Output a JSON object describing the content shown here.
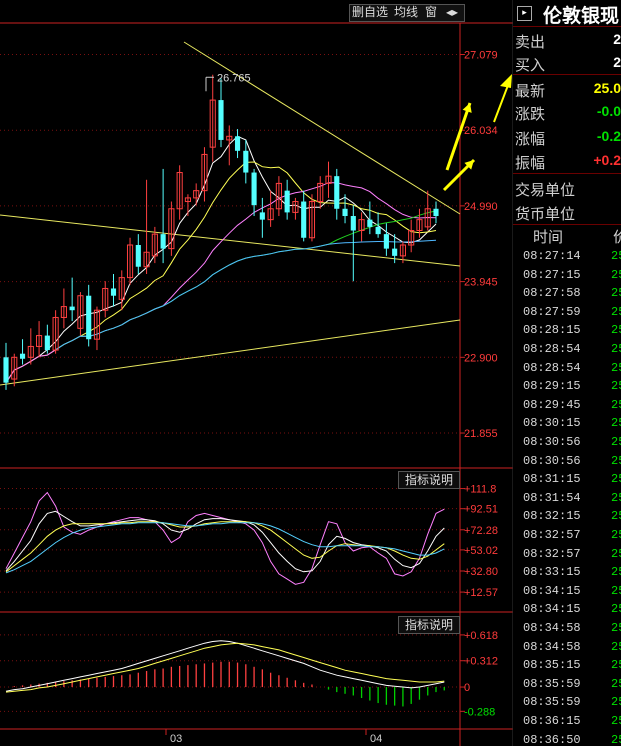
{
  "toolbar": {
    "btn1": "删自选",
    "btn2": "均线",
    "btn3": "窗",
    "btn4": "◂▸"
  },
  "indicator_buttons": {
    "first": "指标说明",
    "second": "指标说明"
  },
  "colors": {
    "up": "#ff4040",
    "down": "#54ffff",
    "axis": "#cc2222",
    "ma1": "#ffffff",
    "ma2": "#ffff55",
    "ma3": "#ff80ff",
    "ma4": "#20d020",
    "ma5": "#4fb8ff"
  },
  "panel": {
    "title": "伦敦银现",
    "quote_rows": [
      {
        "label": "卖出",
        "value": "2",
        "color": "#ffffff"
      },
      {
        "label": "买入",
        "value": "2",
        "color": "#ffffff"
      },
      {
        "label": "最新",
        "value": "25.0",
        "color": "#ffff00"
      },
      {
        "label": "涨跌",
        "value": "-0.0",
        "color": "#00e000"
      },
      {
        "label": "涨幅",
        "value": "-0.2",
        "color": "#00e000"
      },
      {
        "label": "振幅",
        "value": "+0.2",
        "color": "#ff3030"
      },
      {
        "label": "交易单位",
        "value": "",
        "color": "#ffffff"
      },
      {
        "label": "货币单位",
        "value": "",
        "color": "#ffffff"
      }
    ],
    "ticks_header": {
      "time": "时间",
      "price": "价"
    },
    "ticks": [
      {
        "time": "08:27:14",
        "price": "25"
      },
      {
        "time": "08:27:15",
        "price": "25"
      },
      {
        "time": "08:27:58",
        "price": "25"
      },
      {
        "time": "08:27:59",
        "price": "25"
      },
      {
        "time": "08:28:15",
        "price": "25"
      },
      {
        "time": "08:28:54",
        "price": "25"
      },
      {
        "time": "08:28:54",
        "price": "25"
      },
      {
        "time": "08:29:15",
        "price": "25"
      },
      {
        "time": "08:29:45",
        "price": "25"
      },
      {
        "time": "08:30:15",
        "price": "25"
      },
      {
        "time": "08:30:56",
        "price": "25"
      },
      {
        "time": "08:30:56",
        "price": "25"
      },
      {
        "time": "08:31:15",
        "price": "25"
      },
      {
        "time": "08:31:54",
        "price": "25"
      },
      {
        "time": "08:32:15",
        "price": "25"
      },
      {
        "time": "08:32:57",
        "price": "25"
      },
      {
        "time": "08:32:57",
        "price": "25"
      },
      {
        "time": "08:33:15",
        "price": "25"
      },
      {
        "time": "08:34:15",
        "price": "25"
      },
      {
        "time": "08:34:15",
        "price": "25"
      },
      {
        "time": "08:34:58",
        "price": "25"
      },
      {
        "time": "08:34:58",
        "price": "25"
      },
      {
        "time": "08:35:15",
        "price": "25"
      },
      {
        "time": "08:35:59",
        "price": "25"
      },
      {
        "time": "08:35:59",
        "price": "25"
      },
      {
        "time": "08:36:15",
        "price": "25"
      },
      {
        "time": "08:36:50",
        "price": "25"
      }
    ]
  },
  "chart_data": [
    {
      "type": "candlestick",
      "title": "",
      "x_labels": [
        "03",
        "04"
      ],
      "y_ticks": [
        "27.079",
        "26.034",
        "24.990",
        "23.945",
        "22.900",
        "21.855"
      ],
      "ylim": [
        21.4,
        27.5
      ],
      "peak_annotation": "26.765",
      "candles": [
        {
          "o": 22.9,
          "h": 23.1,
          "l": 22.45,
          "c": 22.55
        },
        {
          "o": 22.6,
          "h": 22.95,
          "l": 22.5,
          "c": 22.9
        },
        {
          "o": 22.95,
          "h": 23.15,
          "l": 22.8,
          "c": 22.88
        },
        {
          "o": 22.9,
          "h": 23.3,
          "l": 22.8,
          "c": 23.05
        },
        {
          "o": 23.05,
          "h": 23.4,
          "l": 22.9,
          "c": 23.2
        },
        {
          "o": 23.2,
          "h": 23.35,
          "l": 22.95,
          "c": 23.0
        },
        {
          "o": 23.0,
          "h": 23.55,
          "l": 22.95,
          "c": 23.45
        },
        {
          "o": 23.45,
          "h": 23.85,
          "l": 23.3,
          "c": 23.6
        },
        {
          "o": 23.6,
          "h": 24.0,
          "l": 23.4,
          "c": 23.55
        },
        {
          "o": 23.3,
          "h": 23.8,
          "l": 23.2,
          "c": 23.75
        },
        {
          "o": 23.75,
          "h": 23.9,
          "l": 23.05,
          "c": 23.15
        },
        {
          "o": 23.15,
          "h": 23.6,
          "l": 23.0,
          "c": 23.55
        },
        {
          "o": 23.55,
          "h": 23.95,
          "l": 23.45,
          "c": 23.85
        },
        {
          "o": 23.85,
          "h": 24.05,
          "l": 23.6,
          "c": 23.75
        },
        {
          "o": 23.7,
          "h": 24.1,
          "l": 23.55,
          "c": 24.0
        },
        {
          "o": 24.0,
          "h": 24.55,
          "l": 23.9,
          "c": 24.45
        },
        {
          "o": 24.45,
          "h": 24.6,
          "l": 24.05,
          "c": 24.15
        },
        {
          "o": 24.15,
          "h": 25.35,
          "l": 24.05,
          "c": 24.35
        },
        {
          "o": 24.3,
          "h": 24.7,
          "l": 24.2,
          "c": 24.6
        },
        {
          "o": 24.6,
          "h": 25.5,
          "l": 24.2,
          "c": 24.4
        },
        {
          "o": 24.4,
          "h": 25.05,
          "l": 24.3,
          "c": 24.95
        },
        {
          "o": 24.95,
          "h": 25.55,
          "l": 24.8,
          "c": 25.45
        },
        {
          "o": 25.05,
          "h": 25.15,
          "l": 24.85,
          "c": 25.1
        },
        {
          "o": 25.1,
          "h": 25.3,
          "l": 25.0,
          "c": 25.2
        },
        {
          "o": 25.2,
          "h": 25.8,
          "l": 25.05,
          "c": 25.7
        },
        {
          "o": 25.8,
          "h": 26.8,
          "l": 25.6,
          "c": 26.45
        },
        {
          "o": 26.45,
          "h": 26.75,
          "l": 25.8,
          "c": 25.9
        },
        {
          "o": 25.9,
          "h": 26.1,
          "l": 25.55,
          "c": 25.95
        },
        {
          "o": 25.95,
          "h": 26.05,
          "l": 25.65,
          "c": 25.75
        },
        {
          "o": 25.75,
          "h": 25.9,
          "l": 25.3,
          "c": 25.45
        },
        {
          "o": 25.45,
          "h": 25.5,
          "l": 24.85,
          "c": 25.0
        },
        {
          "o": 24.9,
          "h": 25.1,
          "l": 24.55,
          "c": 24.8
        },
        {
          "o": 24.8,
          "h": 25.2,
          "l": 24.7,
          "c": 24.95
        },
        {
          "o": 24.95,
          "h": 25.4,
          "l": 24.85,
          "c": 25.3
        },
        {
          "o": 25.2,
          "h": 25.35,
          "l": 24.8,
          "c": 24.9
        },
        {
          "o": 24.9,
          "h": 25.1,
          "l": 24.8,
          "c": 25.05
        },
        {
          "o": 25.05,
          "h": 25.2,
          "l": 24.5,
          "c": 24.55
        },
        {
          "o": 24.55,
          "h": 25.15,
          "l": 24.5,
          "c": 25.05
        },
        {
          "o": 25.05,
          "h": 25.4,
          "l": 24.95,
          "c": 25.3
        },
        {
          "o": 25.3,
          "h": 25.6,
          "l": 25.1,
          "c": 25.4
        },
        {
          "o": 25.4,
          "h": 25.5,
          "l": 24.8,
          "c": 24.95
        },
        {
          "o": 24.95,
          "h": 25.15,
          "l": 24.75,
          "c": 24.85
        },
        {
          "o": 24.85,
          "h": 25.0,
          "l": 23.95,
          "c": 24.65
        },
        {
          "o": 24.65,
          "h": 24.9,
          "l": 24.5,
          "c": 24.8
        },
        {
          "o": 24.8,
          "h": 25.05,
          "l": 24.6,
          "c": 24.7
        },
        {
          "o": 24.7,
          "h": 24.9,
          "l": 24.55,
          "c": 24.6
        },
        {
          "o": 24.6,
          "h": 24.75,
          "l": 24.3,
          "c": 24.4
        },
        {
          "o": 24.4,
          "h": 24.6,
          "l": 24.2,
          "c": 24.3
        },
        {
          "o": 24.3,
          "h": 24.5,
          "l": 24.2,
          "c": 24.45
        },
        {
          "o": 24.45,
          "h": 24.8,
          "l": 24.35,
          "c": 24.65
        },
        {
          "o": 24.65,
          "h": 24.95,
          "l": 24.55,
          "c": 24.8
        },
        {
          "o": 24.7,
          "h": 25.2,
          "l": 24.65,
          "c": 24.95
        },
        {
          "o": 24.95,
          "h": 25.05,
          "l": 24.75,
          "c": 24.85
        }
      ]
    },
    {
      "type": "line",
      "title": "",
      "y_ticks": [
        "+111.8",
        "+92.51",
        "+72.28",
        "+53.02",
        "+32.80",
        "+12.57"
      ],
      "ylim": [
        5,
        120
      ],
      "series": [
        {
          "color": "#ff80ff",
          "values": [
            35,
            50,
            65,
            80,
            100,
            108,
            95,
            75,
            70,
            68,
            72,
            75,
            78,
            80,
            82,
            84,
            84,
            82,
            80,
            72,
            60,
            65,
            80,
            86,
            88,
            86,
            84,
            82,
            80,
            78,
            72,
            60,
            42,
            30,
            25,
            20,
            22,
            35,
            58,
            80,
            78,
            60,
            52,
            55,
            56,
            50,
            45,
            30,
            28,
            32,
            45,
            68,
            88,
            92
          ]
        },
        {
          "color": "#ffffff",
          "values": [
            33,
            42,
            52,
            62,
            78,
            88,
            90,
            85,
            80,
            76,
            76,
            77,
            78,
            79,
            80,
            81,
            82,
            82,
            81,
            78,
            72,
            70,
            73,
            78,
            82,
            83,
            83,
            82,
            81,
            80,
            77,
            70,
            60,
            50,
            42,
            35,
            32,
            33,
            42,
            58,
            66,
            64,
            60,
            58,
            57,
            55,
            52,
            44,
            38,
            36,
            40,
            52,
            66,
            74
          ]
        },
        {
          "color": "#ffff55",
          "values": [
            32,
            38,
            44,
            50,
            58,
            66,
            72,
            76,
            78,
            78,
            78,
            78,
            78,
            78,
            79,
            79,
            80,
            80,
            80,
            79,
            77,
            75,
            75,
            76,
            78,
            79,
            80,
            80,
            80,
            80,
            79,
            76,
            72,
            66,
            60,
            54,
            48,
            45,
            46,
            52,
            57,
            59,
            58,
            57,
            57,
            56,
            55,
            52,
            48,
            45,
            44,
            47,
            53,
            59
          ]
        },
        {
          "color": "#54d0ff",
          "values": [
            31,
            34,
            38,
            42,
            48,
            54,
            60,
            65,
            69,
            72,
            74,
            75,
            76,
            77,
            78,
            78,
            79,
            79,
            79,
            79,
            78,
            77,
            76,
            76,
            77,
            78,
            78,
            79,
            79,
            79,
            79,
            78,
            76,
            73,
            69,
            65,
            61,
            58,
            56,
            56,
            57,
            57,
            57,
            57,
            56,
            56,
            55,
            54,
            52,
            50,
            48,
            48,
            50,
            54
          ]
        }
      ]
    },
    {
      "type": "bar",
      "title": "",
      "y_ticks": [
        "+0.618",
        "+0.312",
        "0",
        "-0.288"
      ],
      "ylim": [
        -0.45,
        0.7
      ],
      "macd": [
        0.0,
        0.01,
        0.02,
        0.03,
        0.04,
        0.05,
        0.06,
        0.07,
        0.08,
        0.09,
        0.1,
        0.11,
        0.12,
        0.13,
        0.14,
        0.15,
        0.17,
        0.19,
        0.21,
        0.22,
        0.24,
        0.25,
        0.26,
        0.27,
        0.28,
        0.29,
        0.3,
        0.3,
        0.29,
        0.27,
        0.24,
        0.21,
        0.17,
        0.14,
        0.11,
        0.08,
        0.05,
        0.03,
        0.0,
        -0.03,
        -0.06,
        -0.08,
        -0.1,
        -0.13,
        -0.16,
        -0.19,
        -0.21,
        -0.22,
        -0.23,
        -0.2,
        -0.15,
        -0.1,
        -0.06,
        -0.04
      ],
      "dif": [
        -0.05,
        -0.03,
        -0.02,
        0.0,
        0.02,
        0.04,
        0.06,
        0.08,
        0.1,
        0.12,
        0.14,
        0.16,
        0.18,
        0.2,
        0.22,
        0.25,
        0.28,
        0.31,
        0.34,
        0.37,
        0.4,
        0.43,
        0.46,
        0.49,
        0.52,
        0.54,
        0.55,
        0.54,
        0.52,
        0.49,
        0.46,
        0.43,
        0.4,
        0.37,
        0.34,
        0.31,
        0.28,
        0.24,
        0.2,
        0.17,
        0.14,
        0.12,
        0.1,
        0.08,
        0.06,
        0.04,
        0.02,
        0.01,
        0.0,
        -0.01,
        0.0,
        0.02,
        0.04,
        0.06
      ],
      "dea": [
        -0.06,
        -0.05,
        -0.04,
        -0.03,
        -0.01,
        0.0,
        0.02,
        0.04,
        0.06,
        0.08,
        0.1,
        0.12,
        0.14,
        0.16,
        0.18,
        0.2,
        0.22,
        0.25,
        0.28,
        0.31,
        0.34,
        0.37,
        0.4,
        0.43,
        0.46,
        0.48,
        0.5,
        0.51,
        0.52,
        0.51,
        0.5,
        0.48,
        0.46,
        0.44,
        0.41,
        0.38,
        0.35,
        0.32,
        0.29,
        0.26,
        0.23,
        0.2,
        0.18,
        0.16,
        0.14,
        0.12,
        0.1,
        0.09,
        0.08,
        0.07,
        0.06,
        0.06,
        0.06,
        0.07
      ]
    }
  ]
}
